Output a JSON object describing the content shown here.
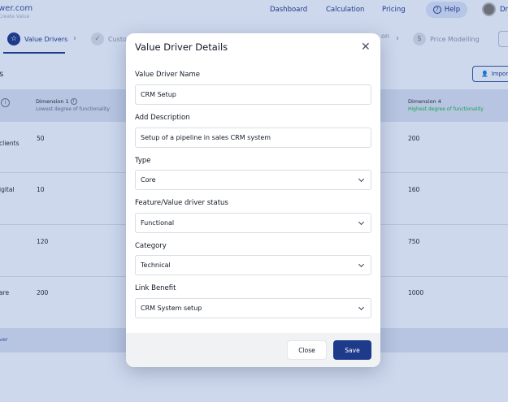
{
  "brand": {
    "name": "wer.com",
    "tagline": "Create Value"
  },
  "nav": {
    "dashboard": "Dashboard",
    "calculation": "Calculation",
    "pricing": "Pricing",
    "help": "Help",
    "user_initials": "Dr"
  },
  "steps": [
    {
      "label": "Value Drivers"
    },
    {
      "label": "Custo"
    },
    {
      "label": "on"
    },
    {
      "label": "Price Modelling"
    }
  ],
  "section": {
    "title": "s",
    "import_label": "Import"
  },
  "table": {
    "headers": {
      "dim1_title": "Dimension 1",
      "dim1_sub": "Lowest degree of functionality",
      "dim4_title": "Dimension 4",
      "dim4_sub": "Highest degree of functionality"
    },
    "rows": [
      {
        "label": "clients",
        "dim1": "50",
        "dim4": "200"
      },
      {
        "label": "igital",
        "dim1": "10",
        "dim4": "160"
      },
      {
        "label": "",
        "dim1": "120",
        "dim4": "750"
      },
      {
        "label": "are",
        "dim1": "200",
        "dim4": "1000"
      }
    ],
    "footer_label": "ver"
  },
  "modal": {
    "title": "Value Driver Details",
    "name_label": "Value Driver Name",
    "name_value": "CRM Setup",
    "desc_label": "Add Description",
    "desc_value": "Setup of a pipeline in sales CRM system",
    "type_label": "Type",
    "type_value": "Core",
    "status_label": "Feature/Value driver status",
    "status_value": "Functional",
    "category_label": "Category",
    "category_value": "Technical",
    "benefit_label": "Link Benefit",
    "benefit_value": "CRM System setup",
    "close_label": "Close",
    "save_label": "Save"
  },
  "colors": {
    "primary": "#1e3a8a",
    "overlay": "#cdd8ed",
    "accent_green": "#16a34a"
  }
}
